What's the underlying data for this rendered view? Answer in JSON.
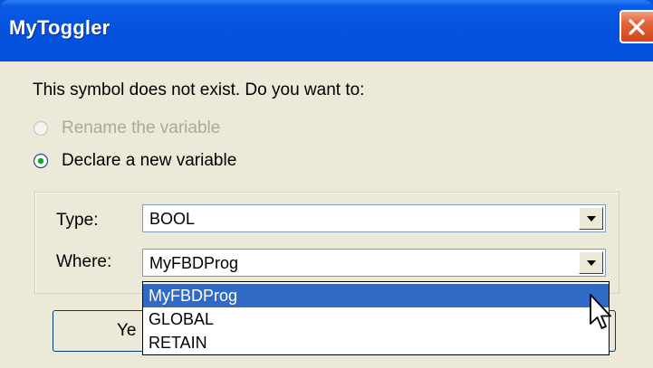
{
  "window": {
    "title": "MyToggler",
    "close_icon": "close-icon"
  },
  "prompt": "This symbol does not exist. Do you want to:",
  "options": [
    {
      "label": "Rename the variable",
      "selected": false,
      "enabled": false
    },
    {
      "label": "Declare a new variable",
      "selected": true,
      "enabled": true
    }
  ],
  "fields": {
    "type": {
      "label": "Type:",
      "value": "BOOL"
    },
    "where": {
      "label": "Where:",
      "value": "MyFBDProg"
    }
  },
  "dropdown": {
    "options": [
      "MyFBDProg",
      "GLOBAL",
      "RETAIN"
    ],
    "selected_index": 0
  },
  "buttons": {
    "yes_partial_label": "Ye"
  },
  "colors": {
    "titlebar": "#0553e0",
    "dialog_bg": "#ece9d8",
    "selection": "#316ac5",
    "close_button": "#d4451c"
  }
}
